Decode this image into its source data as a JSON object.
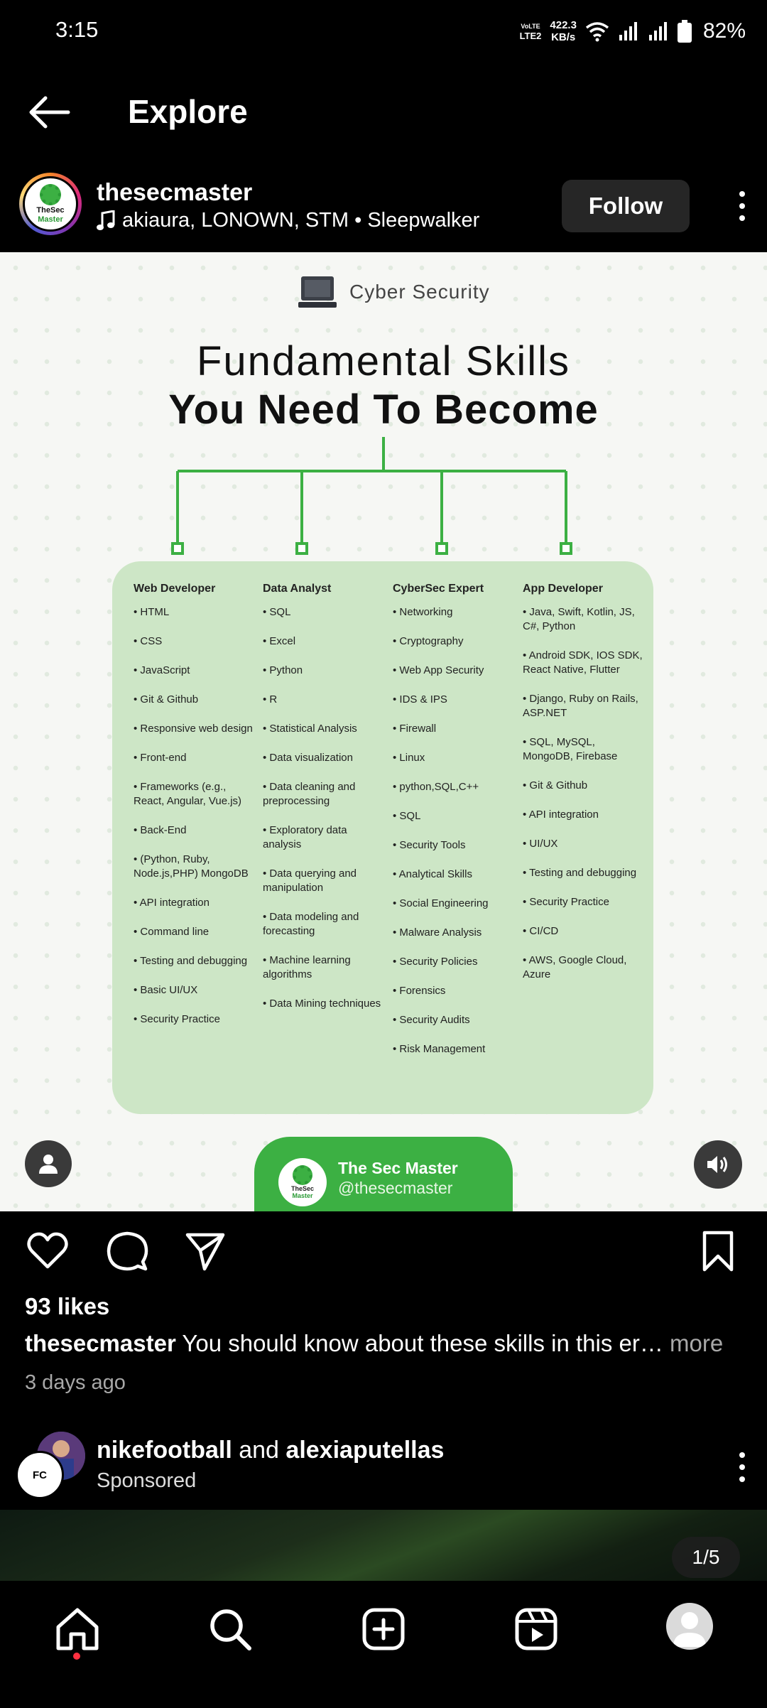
{
  "status_bar": {
    "time": "3:15",
    "volte_top": "VoLTE",
    "volte_bottom": "LTE2",
    "net_speed_value": "422.3",
    "net_speed_unit": "KB/s",
    "battery": "82%"
  },
  "header": {
    "title": "Explore"
  },
  "post": {
    "username": "thesecmaster",
    "avatar_text_1": "TheSec",
    "avatar_text_2": "Master",
    "music": "akiaura, LONOWN, STM • Sleepwalker",
    "follow_label": "Follow",
    "image": {
      "badge": "Cyber Security",
      "title_line1": "Fundamental Skills",
      "title_line2": "You Need To Become",
      "columns": [
        {
          "heading": "Web Developer",
          "items": [
            "• HTML",
            "• CSS",
            "• JavaScript",
            "• Git & Github",
            "• Responsive web design",
            "• Front-end",
            "• Frameworks (e.g., React, Angular, Vue.js)",
            "• Back-End",
            "• (Python, Ruby, Node.js,PHP) MongoDB",
            "• API integration",
            "• Command line",
            "• Testing and debugging",
            "• Basic UI/UX",
            "• Security Practice"
          ]
        },
        {
          "heading": "Data Analyst",
          "items": [
            "• SQL",
            "• Excel",
            "• Python",
            "• R",
            "• Statistical Analysis",
            "• Data visualization",
            "• Data cleaning and preprocessing",
            "• Exploratory data analysis",
            "• Data querying and manipulation",
            "• Data modeling and forecasting",
            "• Machine learning algorithms",
            "• Data Mining techniques"
          ]
        },
        {
          "heading": "CyberSec Expert",
          "items": [
            "• Networking",
            "• Cryptography",
            "• Web App Security",
            "• IDS & IPS",
            "• Firewall",
            "• Linux",
            "• python,SQL,C++",
            "• SQL",
            "• Security Tools",
            "• Analytical Skills",
            "• Social Engineering",
            "• Malware Analysis",
            "• Security Policies",
            "• Forensics",
            "• Security Audits",
            "• Risk Management"
          ]
        },
        {
          "heading": "App Developer",
          "items": [
            "• Java, Swift, Kotlin, JS, C#, Python",
            "• Android SDK, IOS SDK, React Native, Flutter",
            "• Django, Ruby on Rails, ASP.NET",
            "• SQL, MySQL, MongoDB, Firebase",
            "• Git & Github",
            "• API integration",
            "• UI/UX",
            "• Testing and debugging",
            "• Security Practice",
            "• CI/CD",
            "• AWS, Google Cloud, Azure"
          ]
        }
      ],
      "brand_name": "The Sec Master",
      "brand_handle": "@thesecmaster",
      "brand_logo_text_1": "TheSec",
      "brand_logo_text_2": "Master"
    },
    "likes": "93 likes",
    "caption_user": "thesecmaster",
    "caption_text": " You should know about these skills in this er…",
    "caption_more": " more",
    "time_ago": "3 days ago"
  },
  "sponsored": {
    "name1": "nikefootball",
    "joiner": " and ",
    "name2": "alexiaputellas",
    "label": "Sponsored",
    "avatar_text": "FC",
    "page_indicator": "1/5"
  },
  "icons": [
    "back-arrow-icon",
    "music-note-icon",
    "more-vertical-icon",
    "heart-icon",
    "comment-icon",
    "share-icon",
    "bookmark-icon",
    "home-icon",
    "search-icon",
    "create-icon",
    "reels-icon",
    "profile-icon",
    "user-tag-icon",
    "speaker-icon"
  ],
  "colors": {
    "background": "#000000",
    "brand_green": "#3cb043",
    "card_green": "#cde6c6",
    "follow_bg": "#262626",
    "notification_dot": "#ff3040"
  }
}
